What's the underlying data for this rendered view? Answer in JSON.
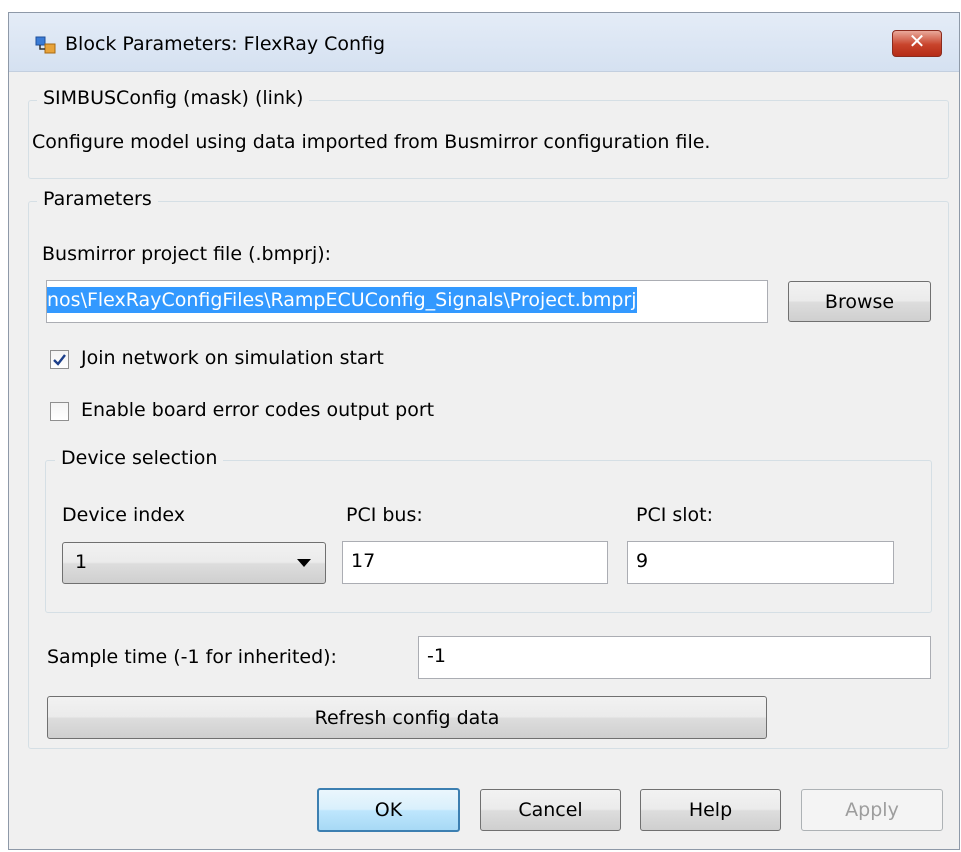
{
  "window": {
    "title": "Block Parameters: FlexRay Config",
    "close_icon": "close-icon"
  },
  "mask": {
    "heading": "SIMBUSConfig (mask) (link)",
    "description": "Configure model using data imported from Busmirror configuration file."
  },
  "parameters": {
    "heading": "Parameters",
    "project_file_label": "Busmirror project file (.bmprj):",
    "project_file_value": "nos\\FlexRayConfigFiles\\RampECUConfig_Signals\\Project.bmprj",
    "browse_label": "Browse",
    "join_network_label": "Join network on simulation start",
    "join_network_checked": true,
    "error_codes_label": "Enable board error codes output port",
    "error_codes_checked": false,
    "device": {
      "heading": "Device selection",
      "index_label": "Device index",
      "index_value": "1",
      "pci_bus_label": "PCI bus:",
      "pci_bus_value": "17",
      "pci_slot_label": "PCI slot:",
      "pci_slot_value": "9"
    },
    "sample_time_label": "Sample time (-1 for inherited):",
    "sample_time_value": "-1",
    "refresh_label": "Refresh config data"
  },
  "footer": {
    "ok_label": "OK",
    "cancel_label": "Cancel",
    "help_label": "Help",
    "apply_label": "Apply"
  },
  "colors": {
    "selection": "#3399ff",
    "default_button_border": "#3c7fb1"
  }
}
